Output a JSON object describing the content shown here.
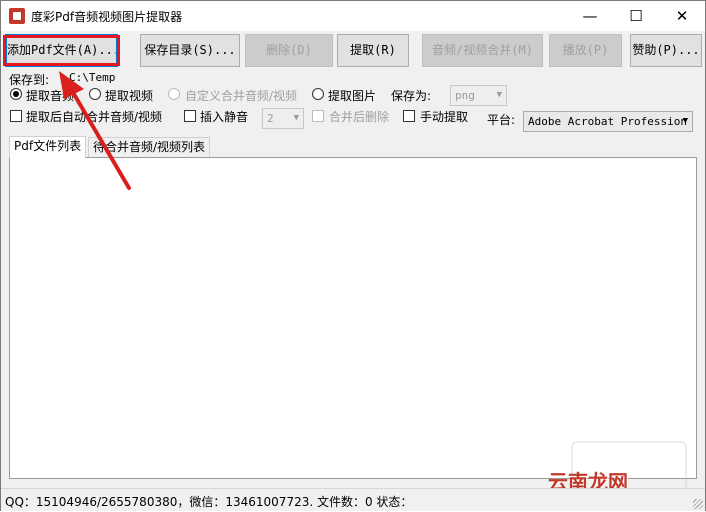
{
  "window": {
    "title": "度彩Pdf音频视频图片提取器",
    "min_glyph": "—",
    "max_glyph": "☐",
    "close_glyph": "✕"
  },
  "toolbar": {
    "add_pdf": "添加Pdf文件(A)...",
    "save_dir": "保存目录(S)...",
    "delete": "删除(D)",
    "extract": "提取(R)",
    "merge_av": "音频/视频合并(M)",
    "play": "播放(P)",
    "donate": "赞助(P)..."
  },
  "save": {
    "label": "保存到:",
    "path": "C:\\Temp"
  },
  "options": {
    "extract_audio": "提取音频",
    "extract_video": "提取视频",
    "custom_merge": "自定义合并音频/视频",
    "extract_image": "提取图片",
    "save_as_label": "保存为:",
    "save_as_value": "png",
    "auto_merge": "提取后自动合并音频/视频",
    "insert_silence": "插入静音",
    "silence_value": "2",
    "delete_after_merge": "合并后删除",
    "manual_extract": "手动提取",
    "platform_label": "平台:",
    "platform_value": "Adobe Acrobat Profession"
  },
  "tabs": {
    "pdf_list": "Pdf文件列表",
    "merge_list": "待合并音频/视频列表"
  },
  "status": {
    "text": "QQ：15104946/2655780380，微信：13461007723. 文件数：0  状态："
  },
  "watermark": {
    "text": "云南龙网"
  },
  "colors": {
    "highlight_box": "#e6161f",
    "arrow": "#d9201f",
    "focus_border": "#0078d7"
  }
}
